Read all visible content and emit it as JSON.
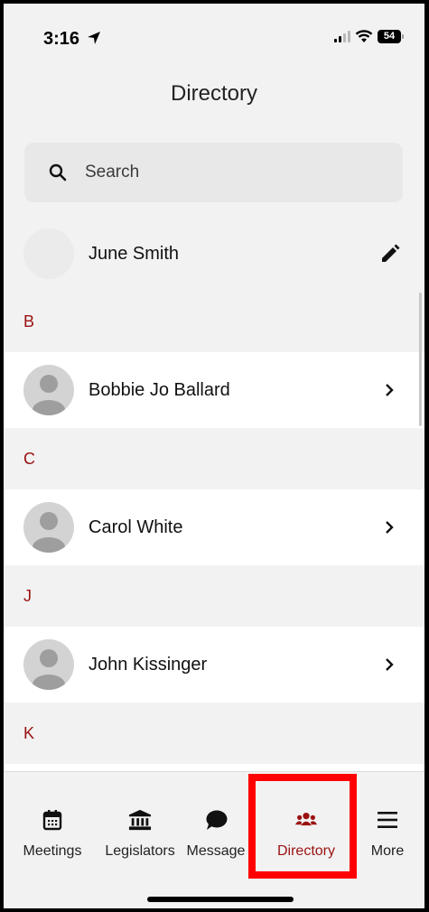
{
  "status": {
    "time": "3:16",
    "battery": "54"
  },
  "header": {
    "title": "Directory"
  },
  "search": {
    "placeholder": "Search"
  },
  "me": {
    "name": "June Smith"
  },
  "sections": [
    {
      "letter": "B",
      "contacts": [
        "Bobbie Jo Ballard"
      ]
    },
    {
      "letter": "C",
      "contacts": [
        "Carol White"
      ]
    },
    {
      "letter": "J",
      "contacts": [
        "John Kissinger"
      ]
    },
    {
      "letter": "K",
      "contacts": []
    }
  ],
  "tabs": [
    {
      "label": "Meetings",
      "icon": "calendar-icon"
    },
    {
      "label": "Legislators",
      "icon": "bank-icon"
    },
    {
      "label": "Message",
      "icon": "chat-bubble-icon"
    },
    {
      "label": "Directory",
      "icon": "users-icon",
      "active": true
    },
    {
      "label": "More",
      "icon": "menu-icon"
    }
  ],
  "colors": {
    "accent": "#9b1111",
    "highlight": "#ff0000"
  }
}
